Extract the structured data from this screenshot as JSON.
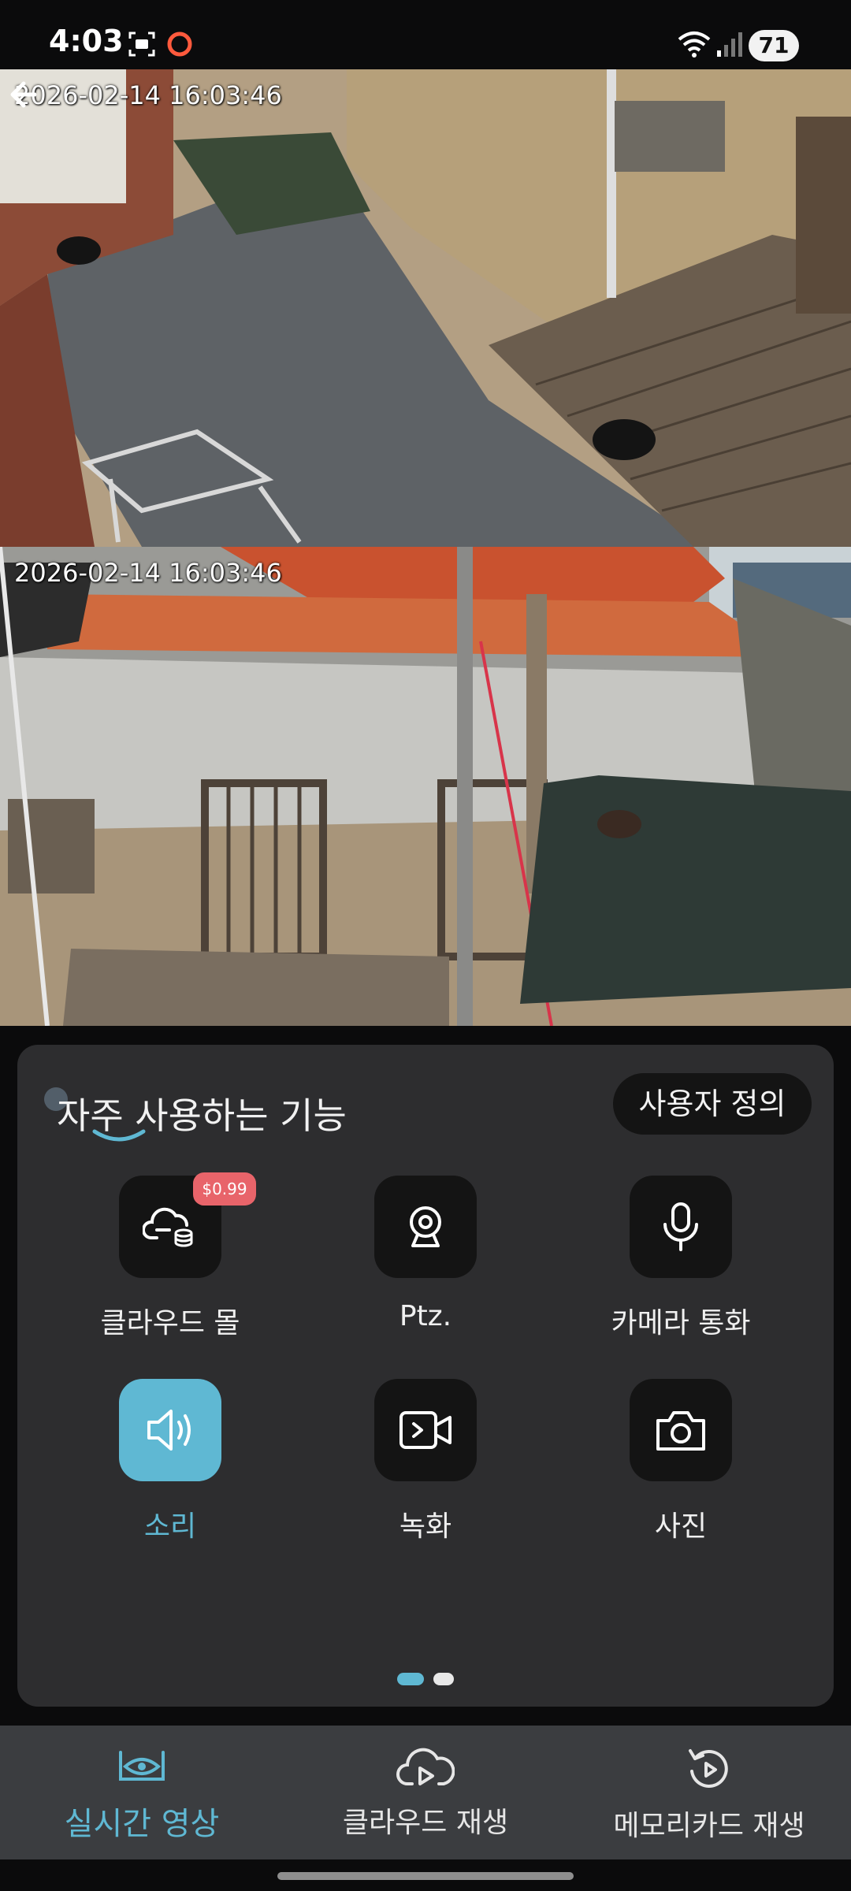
{
  "status_bar": {
    "time": "4:03",
    "battery": "71",
    "icons": [
      "screenshot-icon",
      "record-icon",
      "wifi-icon",
      "signal-icon",
      "battery-icon"
    ]
  },
  "feeds": [
    {
      "timestamp": "2026-02-14 16:03:46"
    },
    {
      "timestamp": "2026-02-14 16:03:46"
    }
  ],
  "panel": {
    "title": "자주 사용하는 기능",
    "custom_button": "사용자 정의",
    "functions": [
      {
        "label": "클라우드 몰",
        "icon": "cloud-shop-icon",
        "badge": "$0.99",
        "active": false
      },
      {
        "label": "Ptz.",
        "icon": "webcam-icon",
        "active": false
      },
      {
        "label": "카메라 통화",
        "icon": "microphone-icon",
        "active": false
      },
      {
        "label": "소리",
        "icon": "speaker-icon",
        "active": true
      },
      {
        "label": "녹화",
        "icon": "video-record-icon",
        "active": false
      },
      {
        "label": "사진",
        "icon": "camera-icon",
        "active": false
      }
    ],
    "page_indicator": {
      "current": 1,
      "total": 2
    }
  },
  "bottom_nav": [
    {
      "label": "실시간 영상",
      "icon": "eye-icon",
      "active": true
    },
    {
      "label": "클라우드 재생",
      "icon": "cloud-play-icon",
      "active": false
    },
    {
      "label": "메모리카드 재생",
      "icon": "replay-icon",
      "active": false
    }
  ],
  "colors": {
    "accent": "#5fb8d3",
    "badge": "#e8646a",
    "panel": "#2d2d2f",
    "nav": "#3b3d40"
  }
}
